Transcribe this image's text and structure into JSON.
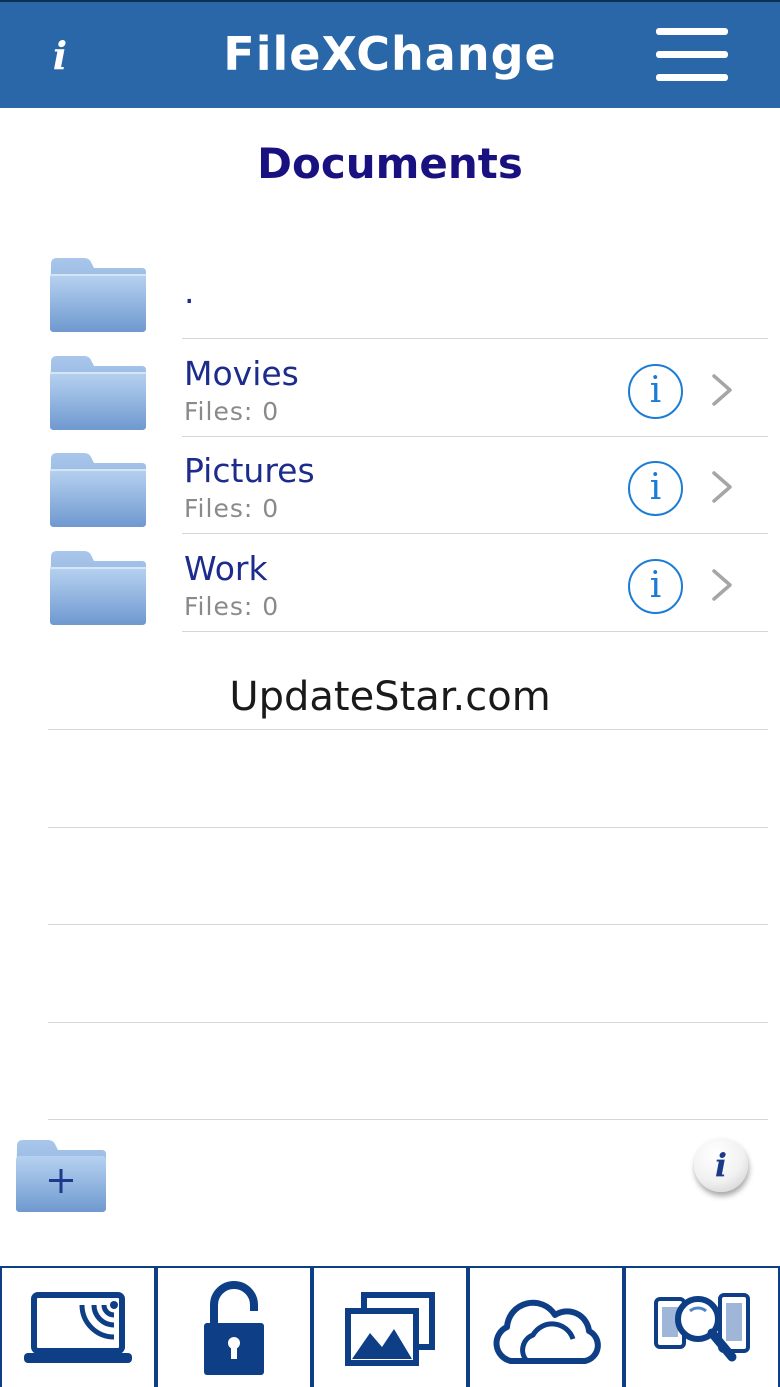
{
  "header": {
    "title": "FileXChange",
    "info_glyph": "i",
    "menu_icon": "hamburger-menu-icon",
    "color": "#2a67a8"
  },
  "page": {
    "title": "Documents"
  },
  "folders": [
    {
      "name": ".",
      "files": ""
    },
    {
      "name": "Movies",
      "files": "Files: 0"
    },
    {
      "name": "Pictures",
      "files": "Files: 0"
    },
    {
      "name": "Work",
      "files": "Files: 0"
    }
  ],
  "info_glyph": "i",
  "watermark": "UpdateStar.com",
  "footer": {
    "new_folder_icon": "new-folder-icon",
    "help_glyph": "i"
  },
  "tabs": [
    {
      "icon": "laptop-wifi-icon"
    },
    {
      "icon": "unlocked-padlock-icon"
    },
    {
      "icon": "photo-gallery-icon"
    },
    {
      "icon": "cloud-icon"
    },
    {
      "icon": "device-search-icon"
    }
  ],
  "colors": {
    "accent": "#2a67a8",
    "title": "#1a1180",
    "folder_name": "#1c2b8c",
    "info_blue": "#1c7cd5",
    "tab_icon": "#0e3f86"
  }
}
